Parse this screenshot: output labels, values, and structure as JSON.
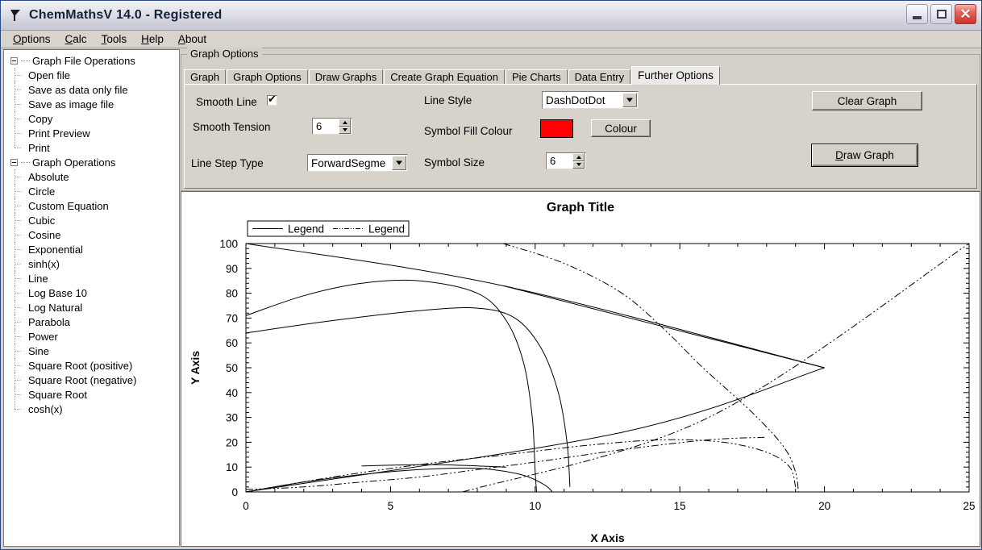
{
  "window": {
    "title": "ChemMathsV 14.0 - Registered",
    "app_icon": "flag-icon",
    "minimize_label": "",
    "maximize_label": "",
    "close_label": "✕"
  },
  "menubar": {
    "items": [
      {
        "label": "Options",
        "accel": "O"
      },
      {
        "label": "Calc",
        "accel": "C"
      },
      {
        "label": "Tools",
        "accel": "T"
      },
      {
        "label": "Help",
        "accel": "H"
      },
      {
        "label": "About",
        "accel": "A"
      }
    ]
  },
  "sidebar": {
    "groups": [
      {
        "label": "Graph File Operations",
        "items": [
          "Open file",
          "Save as data only file",
          "Save as image file",
          "Copy",
          "Print Preview",
          "Print"
        ]
      },
      {
        "label": "Graph Operations",
        "items": [
          "Absolute",
          "Circle",
          "Custom Equation",
          "Cubic",
          "Cosine",
          "Exponential",
          "sinh(x)",
          "Line",
          "Log Base 10",
          "Log Natural",
          "Parabola",
          "Power",
          "Sine",
          "Square Root (positive)",
          "Square Root (negative)",
          "Square Root",
          "cosh(x)"
        ]
      }
    ]
  },
  "panel": {
    "groupbox_label": "Graph Options",
    "tabs": [
      {
        "label": "Graph",
        "active": false
      },
      {
        "label": "Graph Options",
        "active": false
      },
      {
        "label": "Draw Graphs",
        "active": false
      },
      {
        "label": "Create Graph Equation",
        "active": false
      },
      {
        "label": "Pie Charts",
        "active": false
      },
      {
        "label": "Data Entry",
        "active": false
      },
      {
        "label": "Further Options",
        "active": true
      }
    ],
    "controls": {
      "smooth_line_label": "Smooth Line",
      "smooth_line_checked": true,
      "smooth_tension_label": "Smooth Tension",
      "smooth_tension_value": "6",
      "line_step_type_label": "Line Step Type",
      "line_step_type_value": "ForwardSegme",
      "line_style_label": "Line Style",
      "line_style_value": "DashDotDot",
      "symbol_fill_colour_label": "Symbol Fill Colour",
      "symbol_fill_colour_hex": "#FF0000",
      "colour_button_label": "Colour",
      "symbol_size_label": "Symbol Size",
      "symbol_size_value": "6",
      "clear_graph_label": "Clear Graph",
      "draw_graph_label": "Draw Graph",
      "draw_graph_accel": "D"
    }
  },
  "chart_data": {
    "type": "line",
    "title": "Graph Title",
    "xlabel": "X Axis",
    "ylabel": "Y Axis",
    "xlim": [
      0,
      25
    ],
    "ylim": [
      0,
      100
    ],
    "xticks": [
      0,
      5,
      10,
      15,
      20,
      25
    ],
    "yticks": [
      0,
      10,
      20,
      30,
      40,
      50,
      60,
      70,
      80,
      90,
      100
    ],
    "xtick_labels": [
      "0",
      "5",
      "10",
      "15",
      "20",
      "25"
    ],
    "ytick_labels": [
      "0",
      "10",
      "20",
      "30",
      "40",
      "50",
      "60",
      "70",
      "80",
      "90",
      "100"
    ],
    "minor_ticks": true,
    "grid": false,
    "legend": {
      "position": "top-left",
      "entries": [
        {
          "label": "Legend",
          "style": "solid"
        },
        {
          "label": "Legend",
          "style": "dashdotdot"
        }
      ]
    },
    "series": [
      {
        "name": "arc-upper-solid",
        "style": "solid",
        "points": [
          [
            0,
            71
          ],
          [
            2,
            79
          ],
          [
            4,
            84
          ],
          [
            6,
            85
          ],
          [
            8,
            80
          ],
          [
            9,
            69
          ],
          [
            9.6,
            52
          ],
          [
            9.9,
            30
          ],
          [
            10,
            8
          ],
          [
            10.05,
            0
          ]
        ]
      },
      {
        "name": "arc-lower-solid",
        "style": "solid",
        "points": [
          [
            0,
            64
          ],
          [
            3,
            69
          ],
          [
            6,
            73
          ],
          [
            8,
            74
          ],
          [
            9.3,
            70
          ],
          [
            10.2,
            58
          ],
          [
            10.8,
            40
          ],
          [
            11.1,
            20
          ],
          [
            11.2,
            2
          ]
        ]
      },
      {
        "name": "peak-line-solid",
        "style": "solid",
        "points": [
          [
            0,
            100
          ],
          [
            8.9,
            83
          ],
          [
            20,
            50
          ]
        ]
      },
      {
        "name": "descend-line-solid",
        "style": "solid",
        "points": [
          [
            8.9,
            83
          ],
          [
            20,
            50
          ]
        ]
      },
      {
        "name": "rising-line-solid",
        "style": "solid",
        "points": [
          [
            0,
            0
          ],
          [
            13,
            24
          ],
          [
            20,
            50
          ]
        ]
      },
      {
        "name": "low-arc-solid",
        "style": "solid",
        "points": [
          [
            0,
            0
          ],
          [
            2,
            4
          ],
          [
            4,
            7
          ],
          [
            6,
            9
          ],
          [
            8,
            9.5
          ],
          [
            9.5,
            7
          ],
          [
            10.3,
            3
          ],
          [
            10.6,
            0
          ]
        ]
      },
      {
        "name": "flat-segment-solid",
        "style": "solid",
        "points": [
          [
            4.0,
            10.5
          ],
          [
            6.5,
            11.0
          ],
          [
            9.0,
            10.0
          ]
        ]
      },
      {
        "name": "diagonal-dashdotdot",
        "style": "dashdotdot",
        "points": [
          [
            7.5,
            0
          ],
          [
            16,
            30
          ],
          [
            25,
            100
          ]
        ]
      },
      {
        "name": "upper-arc-dashdotdot",
        "style": "dashdotdot",
        "points": [
          [
            8.9,
            100
          ],
          [
            11,
            92
          ],
          [
            13,
            80
          ],
          [
            14.5,
            65
          ],
          [
            15.8,
            50
          ],
          [
            17.5,
            32
          ],
          [
            18.6,
            18
          ],
          [
            19.0,
            8
          ],
          [
            19.1,
            0
          ]
        ]
      },
      {
        "name": "low-arc-dashdotdot",
        "style": "dashdotdot",
        "points": [
          [
            0,
            0
          ],
          [
            3,
            6
          ],
          [
            6,
            11
          ],
          [
            9,
            15
          ],
          [
            12,
            19
          ],
          [
            14.5,
            21
          ],
          [
            16.5,
            20
          ],
          [
            18,
            16
          ],
          [
            18.8,
            10
          ],
          [
            19.0,
            2
          ]
        ]
      },
      {
        "name": "baseline-dashdotdot",
        "style": "dashdotdot",
        "points": [
          [
            0,
            1
          ],
          [
            2,
            2
          ],
          [
            4,
            4
          ],
          [
            6,
            6
          ],
          [
            8,
            9
          ],
          [
            10,
            12
          ],
          [
            13,
            17
          ],
          [
            16,
            21
          ],
          [
            18,
            22
          ]
        ]
      }
    ]
  }
}
